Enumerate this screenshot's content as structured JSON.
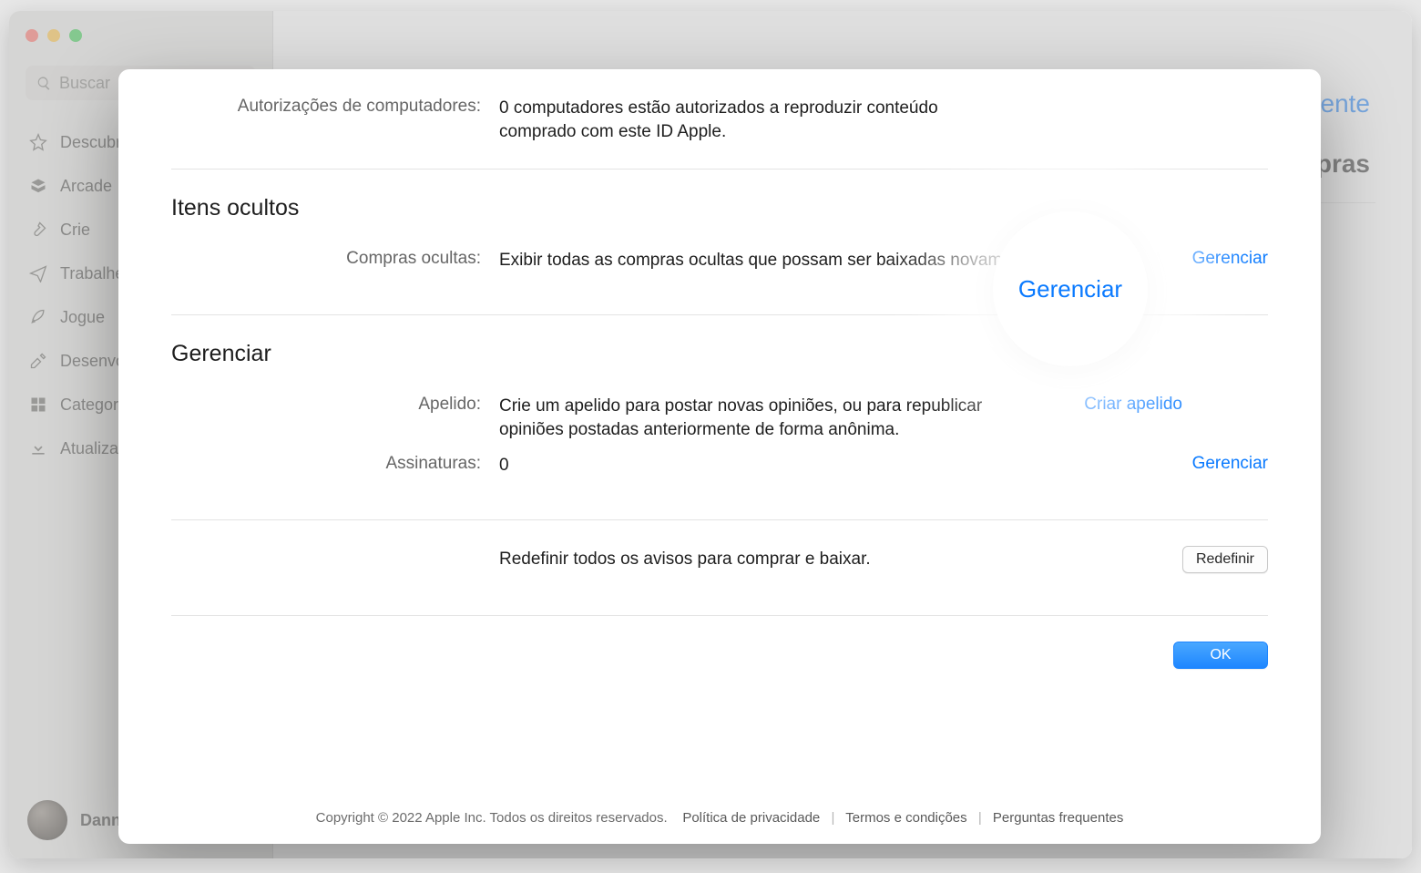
{
  "search": {
    "placeholder": "Buscar"
  },
  "sidebar": {
    "items": [
      {
        "label": "Descubra"
      },
      {
        "label": "Arcade"
      },
      {
        "label": "Crie"
      },
      {
        "label": "Trabalhe"
      },
      {
        "label": "Jogue"
      },
      {
        "label": "Desenvolva"
      },
      {
        "label": "Categorias"
      },
      {
        "label": "Atualizações"
      }
    ]
  },
  "user": {
    "name": "Danny Rico"
  },
  "background": {
    "present_link_suffix": "esente",
    "right_word_suffix": "mpras"
  },
  "sheet": {
    "auth": {
      "label": "Autorizações de computadores:",
      "text": "0 computadores estão autorizados a reproduzir conteúdo comprado com este ID Apple."
    },
    "hidden": {
      "title": "Itens ocultos",
      "label": "Compras ocultas:",
      "text": "Exibir todas as compras ocultas que possam ser baixadas novamente.",
      "action": "Gerenciar"
    },
    "manage": {
      "title": "Gerenciar",
      "nickname_label": "Apelido:",
      "nickname_text": "Crie um apelido para postar novas opiniões, ou para republicar opiniões postadas anteriormente de forma anônima.",
      "nickname_action": "Criar apelido",
      "subs_label": "Assinaturas:",
      "subs_value": "0",
      "subs_action": "Gerenciar",
      "reset_text": "Redefinir todos os avisos para comprar e baixar.",
      "reset_button": "Redefinir",
      "ok_button": "OK"
    },
    "footer": {
      "copyright": "Copyright © 2022 Apple Inc. Todos os direitos reservados.",
      "privacy": "Política de privacidade",
      "terms": "Termos e condições",
      "faq": "Perguntas frequentes"
    }
  },
  "spotlight": {
    "label": "Gerenciar"
  }
}
